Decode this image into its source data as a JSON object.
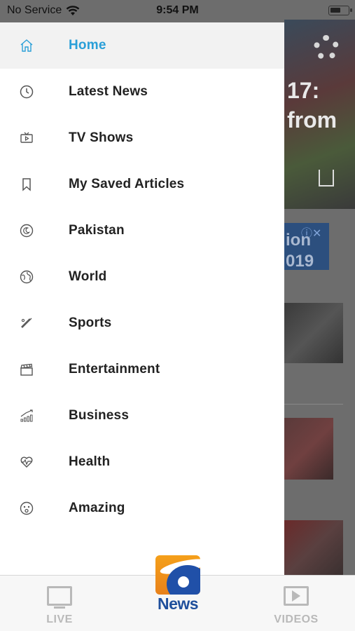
{
  "status_bar": {
    "carrier": "No Service",
    "time": "9:54 PM"
  },
  "background": {
    "headline_fragment_1": "17:",
    "headline_fragment_2": "from",
    "ad_line_1": "ion",
    "ad_line_2": "019"
  },
  "menu": {
    "items": [
      {
        "label": "Home",
        "icon": "home-icon",
        "active": true
      },
      {
        "label": "Latest News",
        "icon": "clock-icon"
      },
      {
        "label": "TV Shows",
        "icon": "tv-icon"
      },
      {
        "label": "My Saved Articles",
        "icon": "bookmark-icon"
      },
      {
        "label": "Pakistan",
        "icon": "crescent-icon"
      },
      {
        "label": "World",
        "icon": "globe-icon"
      },
      {
        "label": "Sports",
        "icon": "cricket-bat-icon"
      },
      {
        "label": "Entertainment",
        "icon": "clapperboard-icon"
      },
      {
        "label": "Business",
        "icon": "growth-chart-icon"
      },
      {
        "label": "Health",
        "icon": "heartbeat-icon"
      },
      {
        "label": "Amazing",
        "icon": "surprised-face-icon"
      }
    ]
  },
  "tab_bar": {
    "live_label": "LIVE",
    "news_label": "News",
    "videos_label": "VIDEOS"
  },
  "colors": {
    "active": "#2a9fd8",
    "brand_blue": "#1f4f9c",
    "brand_orange": "#f5a01a",
    "inactive_tab": "#b9b9b9"
  }
}
